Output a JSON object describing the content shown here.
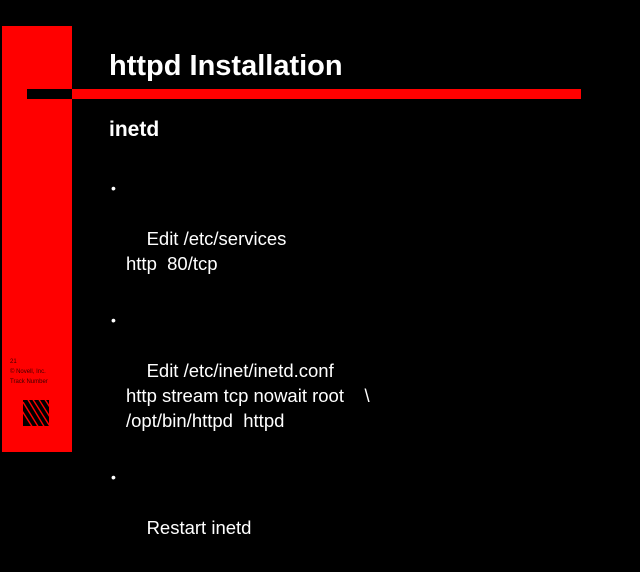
{
  "slide": {
    "title": "httpd Installation",
    "subtitle": "inetd",
    "bullet_glyph": "•",
    "bullets": [
      {
        "text": "Edit /etc/services\nhttp  80/tcp"
      },
      {
        "text": "Edit /etc/inet/inetd.conf\nhttp stream tcp nowait root    \\\n/opt/bin/httpd  httpd"
      },
      {
        "text": "Restart inetd"
      }
    ]
  },
  "sidebar": {
    "page_number": "21",
    "copyright": "© Novell, Inc.",
    "track_label": "Track Number"
  },
  "colors": {
    "background": "#000000",
    "accent": "#ff0000",
    "text": "#ffffff"
  },
  "icons": {
    "logo": "novell-logo-icon"
  }
}
